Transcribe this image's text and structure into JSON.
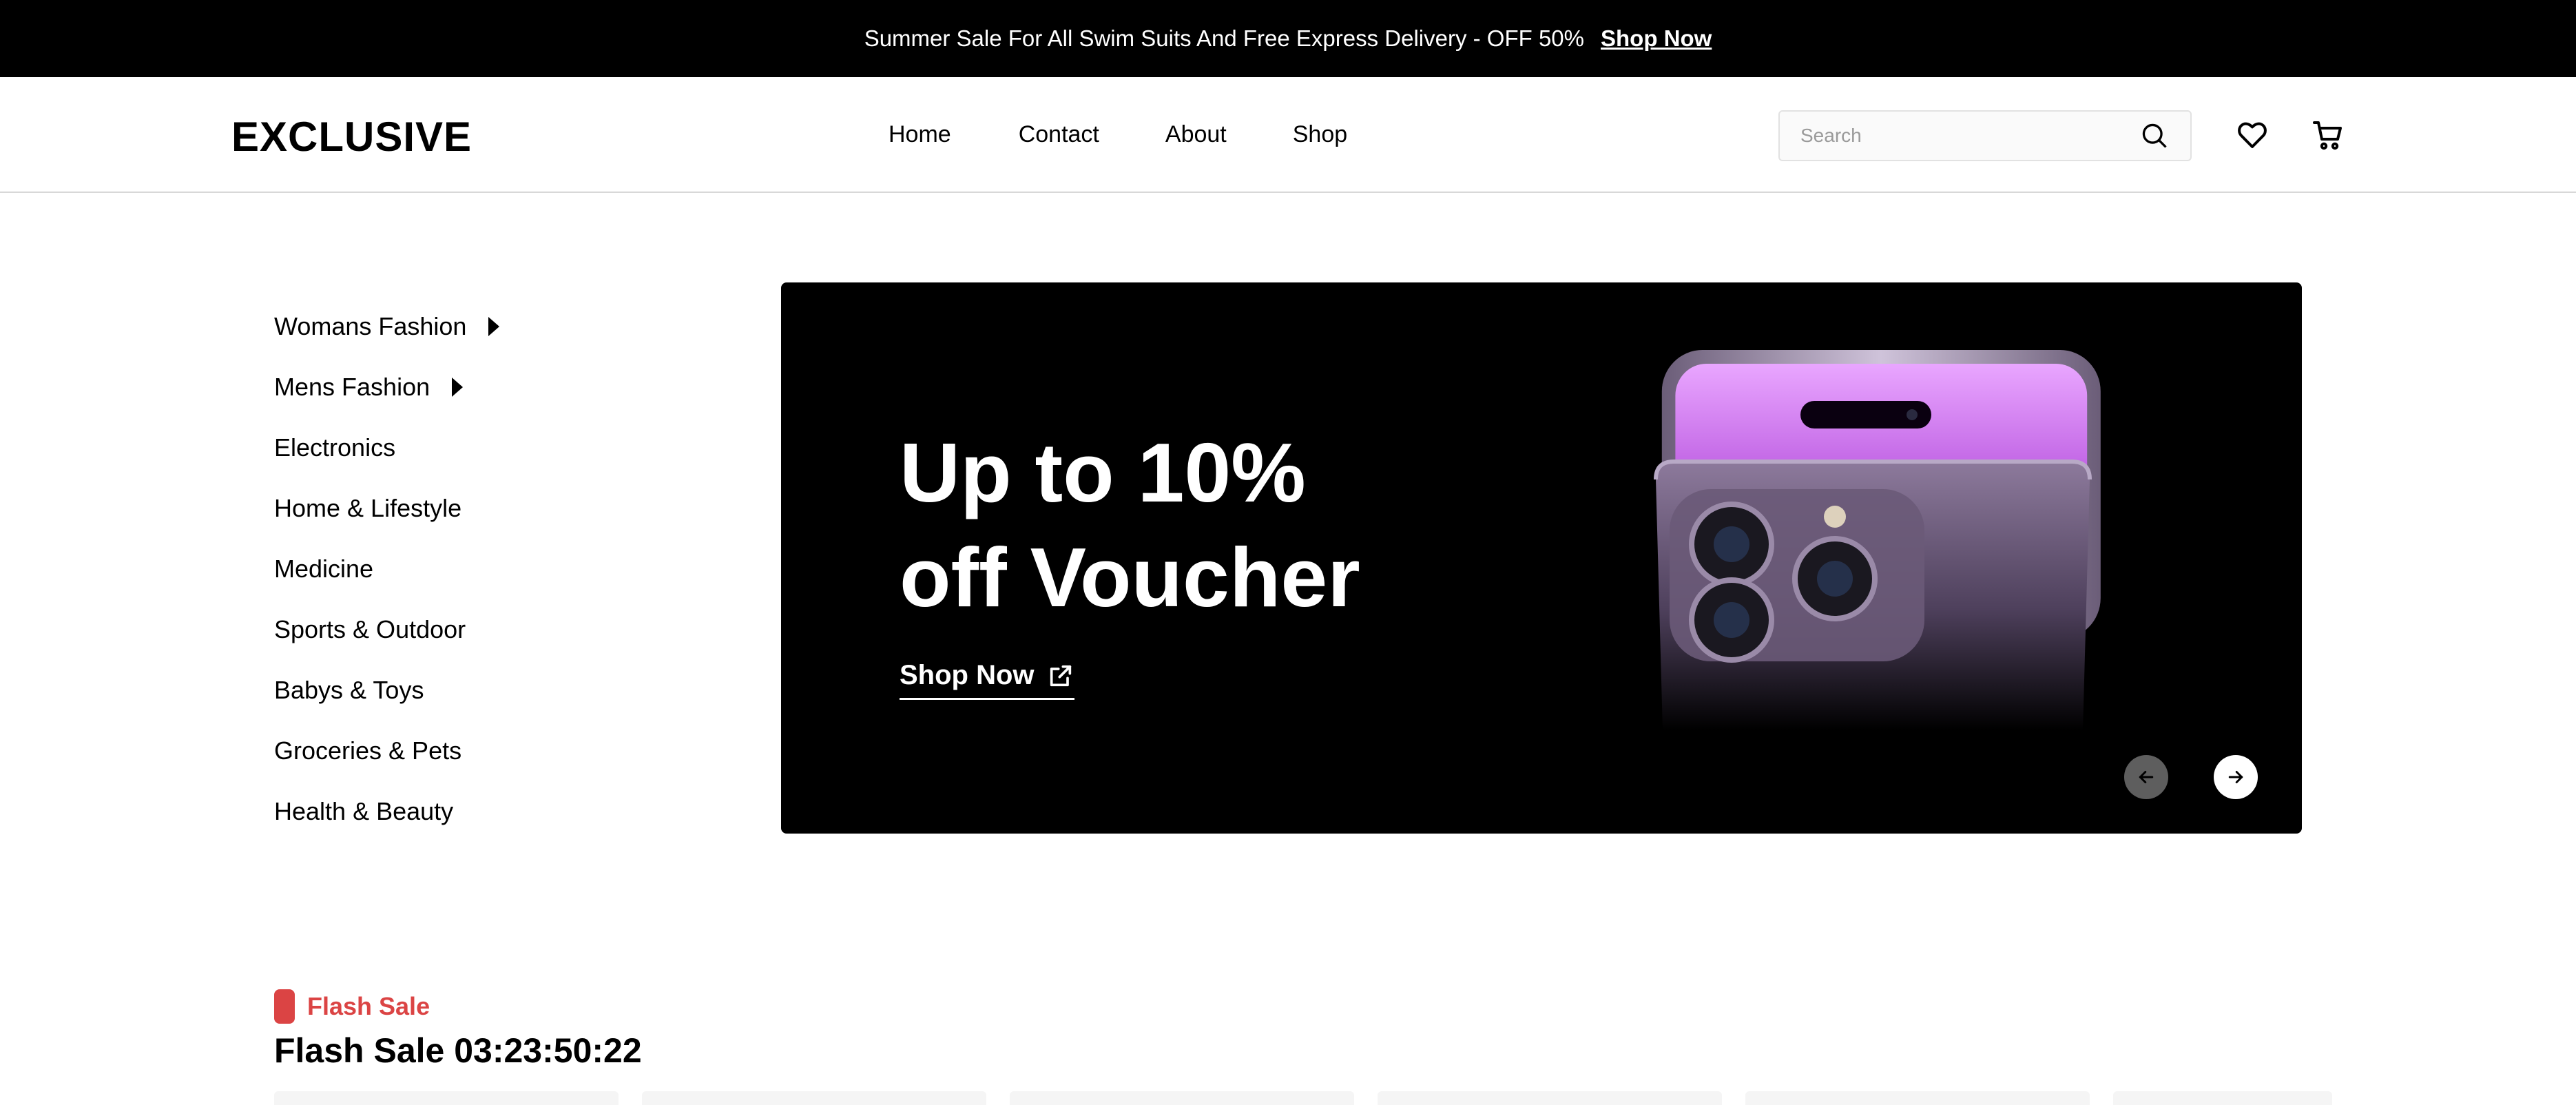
{
  "topbar": {
    "message": "Summer Sale For All Swim Suits And Free Express Delivery - OFF 50%",
    "link": "Shop Now"
  },
  "header": {
    "logo": "EXCLUSIVE",
    "nav": [
      "Home",
      "Contact",
      "About",
      "Shop"
    ],
    "search_placeholder": "Search",
    "icons": [
      "search-icon",
      "heart-icon",
      "cart-icon"
    ]
  },
  "sidebar": {
    "categories": [
      {
        "label": "Womans Fashion",
        "has_submenu": true
      },
      {
        "label": "Mens Fashion",
        "has_submenu": true
      },
      {
        "label": "Electronics"
      },
      {
        "label": "Home & Lifestyle"
      },
      {
        "label": "Medicine"
      },
      {
        "label": "Sports & Outdoor"
      },
      {
        "label": "Babys & Toys"
      },
      {
        "label": "Groceries & Pets"
      },
      {
        "label": "Health & Beauty"
      }
    ]
  },
  "hero": {
    "title_line1": "Up to 10%",
    "title_line2": "off Voucher",
    "cta": "Shop Now",
    "product_image": "purple-smartphone"
  },
  "flash_sale": {
    "tag": "Flash Sale",
    "title": "Flash Sale 03:23:50:22"
  },
  "colors": {
    "accent": "#db4444",
    "topbar_bg": "#000000",
    "hero_bg": "#000000"
  }
}
